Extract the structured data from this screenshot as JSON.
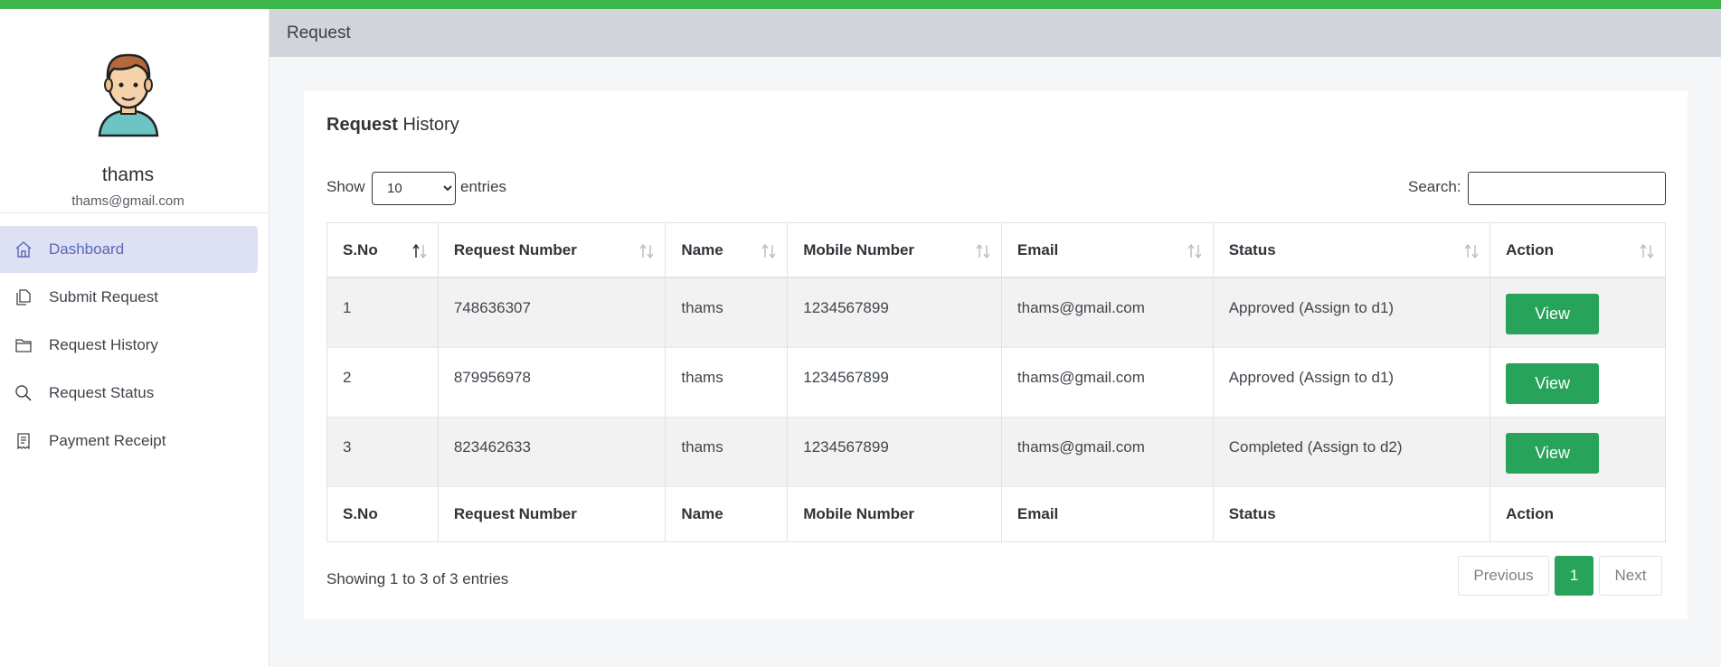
{
  "header": {
    "title": "Request"
  },
  "user": {
    "name": "thams",
    "email": "thams@gmail.com"
  },
  "nav": [
    {
      "label": "Dashboard",
      "icon": "home-icon",
      "active": true
    },
    {
      "label": "Submit Request",
      "icon": "documents-icon",
      "active": false
    },
    {
      "label": "Request History",
      "icon": "folder-icon",
      "active": false
    },
    {
      "label": "Request Status",
      "icon": "search-icon",
      "active": false
    },
    {
      "label": "Payment Receipt",
      "icon": "receipt-icon",
      "active": false
    }
  ],
  "card": {
    "title_bold": "Request",
    "title_rest": " History"
  },
  "controls": {
    "show_label": "Show",
    "entries_label": "entries",
    "page_length": "10",
    "search_label": "Search:",
    "search_value": ""
  },
  "table": {
    "columns": [
      "S.No",
      "Request Number",
      "Name",
      "Mobile Number",
      "Email",
      "Status",
      "Action"
    ],
    "rows": [
      {
        "sno": "1",
        "request_number": "748636307",
        "name": "thams",
        "mobile": "1234567899",
        "email": "thams@gmail.com",
        "status": "Approved (Assign to d1)",
        "action": "View"
      },
      {
        "sno": "2",
        "request_number": "879956978",
        "name": "thams",
        "mobile": "1234567899",
        "email": "thams@gmail.com",
        "status": "Approved (Assign to d1)",
        "action": "View"
      },
      {
        "sno": "3",
        "request_number": "823462633",
        "name": "thams",
        "mobile": "1234567899",
        "email": "thams@gmail.com",
        "status": "Completed (Assign to d2)",
        "action": "View"
      }
    ]
  },
  "footer": {
    "info": "Showing 1 to 3 of 3 entries",
    "previous": "Previous",
    "page": "1",
    "next": "Next"
  },
  "colors": {
    "accent_green": "#3cb54a",
    "button_green": "#27a35a",
    "active_nav_bg": "#dde1f3",
    "header_bg": "#d1d5db"
  }
}
